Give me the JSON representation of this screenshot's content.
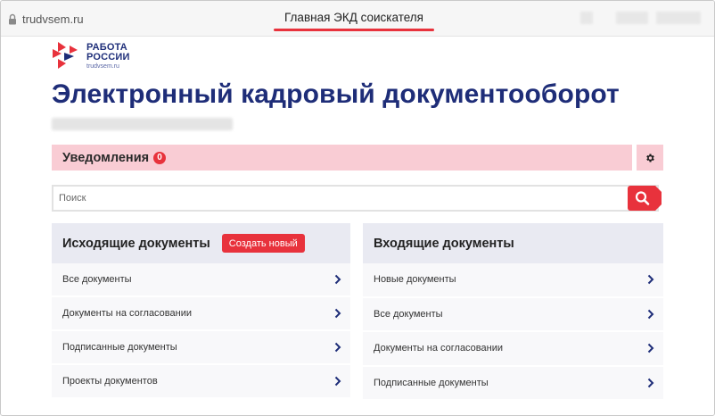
{
  "browser": {
    "url": "trudvsem.ru",
    "tab_title": "Главная ЭКД соискателя",
    "accent": "#e8323c"
  },
  "logo": {
    "line1": "РАБОТА",
    "line2": "РОССИИ",
    "site": "trudvsem.ru"
  },
  "page": {
    "title": "Электронный кадровый документооборот"
  },
  "notifications": {
    "label": "Уведомления",
    "count": "0",
    "settings_icon": "gear-icon"
  },
  "search": {
    "placeholder": "Поиск",
    "value": "",
    "icon": "search-icon"
  },
  "outgoing": {
    "title": "Исходящие документы",
    "create_label": "Создать новый",
    "items": [
      {
        "label": "Все документы"
      },
      {
        "label": "Документы на согласовании"
      },
      {
        "label": "Подписанные документы"
      },
      {
        "label": "Проекты документов"
      }
    ]
  },
  "incoming": {
    "title": "Входящие документы",
    "items": [
      {
        "label": "Новые документы"
      },
      {
        "label": "Все документы"
      },
      {
        "label": "Документы на согласовании"
      },
      {
        "label": "Подписанные документы"
      }
    ]
  },
  "colors": {
    "brand_blue": "#1e2d78",
    "notif_bg": "#f9ccd4",
    "panel_head_bg": "#e9eaf2",
    "accent_red": "#e8323c"
  }
}
